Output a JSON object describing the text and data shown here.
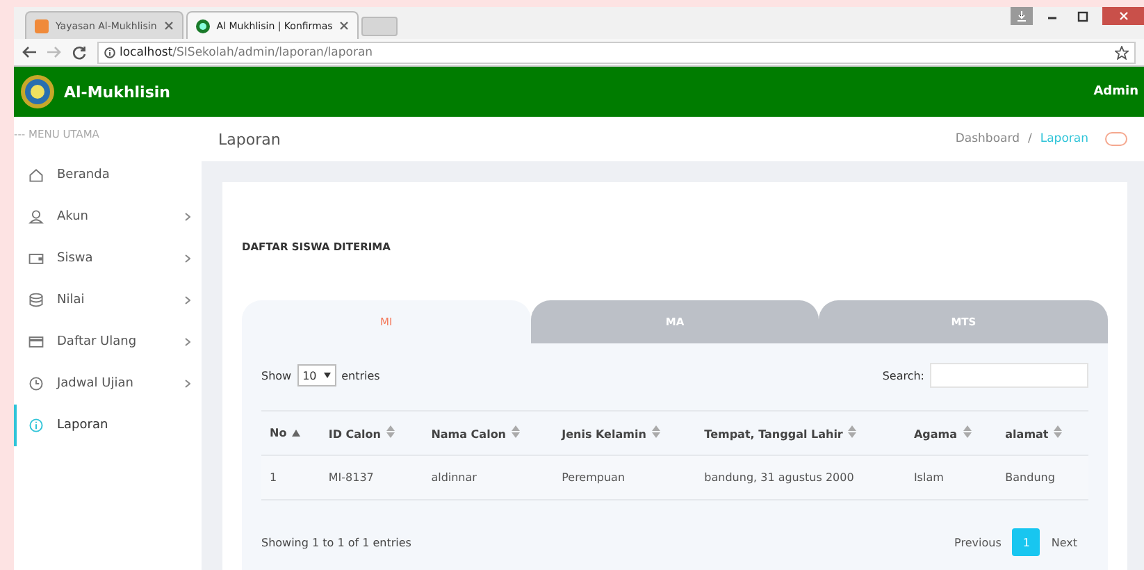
{
  "browser": {
    "tabs": [
      {
        "title": "Yayasan Al-Mukhlisin",
        "selected": false
      },
      {
        "title": "Al Mukhlisin | Konfirmas",
        "selected": true
      }
    ],
    "url_host": "localhost",
    "url_path": "/SISekolah/admin/laporan/laporan"
  },
  "header": {
    "brand": "Al-Mukhlisin",
    "user": "Admin"
  },
  "sidebar": {
    "heading": "--- MENU UTAMA",
    "items": [
      {
        "label": "Beranda",
        "has_submenu": false,
        "selected": false
      },
      {
        "label": "Akun",
        "has_submenu": true,
        "selected": false
      },
      {
        "label": "Siswa",
        "has_submenu": true,
        "selected": false
      },
      {
        "label": "Nilai",
        "has_submenu": true,
        "selected": false
      },
      {
        "label": "Daftar Ulang",
        "has_submenu": true,
        "selected": false
      },
      {
        "label": "Jadwal Ujian",
        "has_submenu": true,
        "selected": false
      },
      {
        "label": "Laporan",
        "has_submenu": false,
        "selected": true
      }
    ]
  },
  "page": {
    "title": "Laporan",
    "breadcrumb": [
      {
        "label": "Dashboard",
        "selected": false
      },
      {
        "label": "Laporan",
        "selected": true
      }
    ],
    "separator": "/"
  },
  "card": {
    "title": "DAFTAR SISWA DITERIMA",
    "tabs": [
      {
        "label": "MI",
        "selected": true
      },
      {
        "label": "MA",
        "selected": false
      },
      {
        "label": "MTS",
        "selected": false
      }
    ],
    "length": {
      "before": "Show",
      "value": "10",
      "after": "entries"
    },
    "search_label": "Search:",
    "table": {
      "columns": [
        {
          "label": "No",
          "sorted": true
        },
        {
          "label": "ID Calon",
          "sorted": false
        },
        {
          "label": "Nama Calon",
          "sorted": false
        },
        {
          "label": "Jenis Kelamin",
          "sorted": false
        },
        {
          "label": "Tempat, Tanggal Lahir",
          "sorted": false
        },
        {
          "label": "Agama",
          "sorted": false
        },
        {
          "label": "alamat",
          "sorted": false
        }
      ],
      "rows": [
        [
          "1",
          "MI-8137",
          "aldinnar",
          "Perempuan",
          "bandung, 31 agustus 2000",
          "Islam",
          "Bandung"
        ]
      ]
    },
    "info": "Showing 1 to 1 of 1 entries",
    "pagination": [
      {
        "label": "Previous",
        "selected": false
      },
      {
        "label": "1",
        "selected": true
      },
      {
        "label": "Next",
        "selected": false
      }
    ]
  }
}
